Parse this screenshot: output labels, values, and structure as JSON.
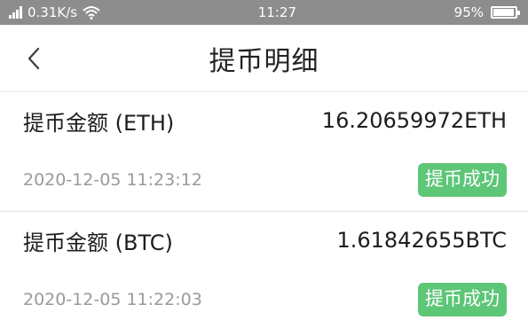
{
  "status_bar": {
    "network_speed": "0.31K/s",
    "time": "11:27",
    "battery": "95%",
    "battery_level": 0.95,
    "icons": [
      "signal-icon",
      "wifi-icon",
      "battery-icon"
    ]
  },
  "header": {
    "title": "提币明细",
    "back_icon": "chevron-left-icon"
  },
  "records": [
    {
      "label": "提币金额 (ETH)",
      "amount": "16.20659972ETH",
      "time": "2020-12-05 11:23:12",
      "status": "提币成功"
    },
    {
      "label": "提币金额 (BTC)",
      "amount": "1.61842655BTC",
      "time": "2020-12-05 11:22:03",
      "status": "提币成功"
    }
  ],
  "colors": {
    "status_bar": "#8d8d8d",
    "success_badge": "#5dc677",
    "timestamp": "#9a9a9a"
  }
}
